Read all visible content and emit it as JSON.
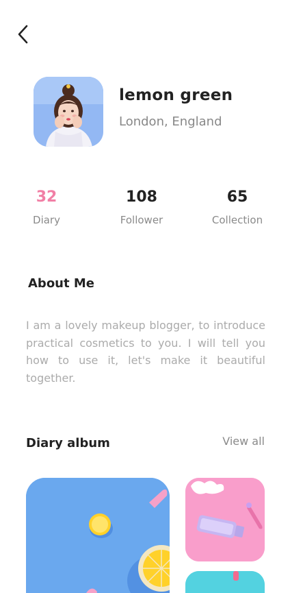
{
  "header": {
    "back_icon": "chevron-left-icon"
  },
  "profile": {
    "name": "lemon green",
    "location": "London, England"
  },
  "stats": [
    {
      "value": "32",
      "label": "Diary"
    },
    {
      "value": "108",
      "label": "Follower"
    },
    {
      "value": "65",
      "label": "Collection"
    }
  ],
  "about": {
    "title": "About Me",
    "text": "I am a lovely makeup blogger, to introduce practical cosmetics to you. I will tell you how to use it, let's make it beautiful together."
  },
  "album": {
    "title": "Diary album",
    "view_all": "View all"
  },
  "colors": {
    "accent": "#f17fa5",
    "text": "#222222",
    "muted": "#8a8a8a",
    "body_text": "#ababab"
  }
}
